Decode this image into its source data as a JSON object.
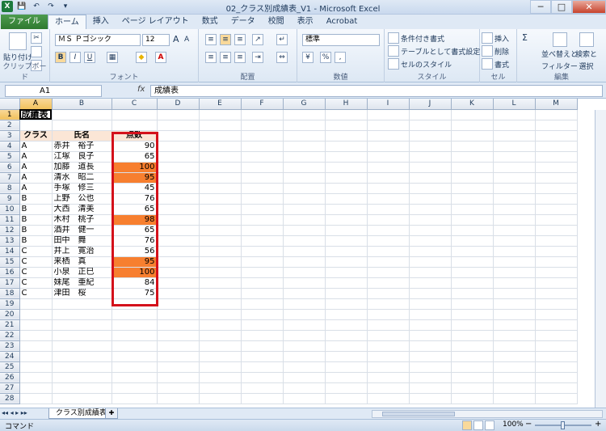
{
  "window": {
    "title": "02_クラス別成績表_V1 - Microsoft Excel",
    "minimize": "─",
    "maximize": "□",
    "close": "✕"
  },
  "qat": {
    "logo": "X",
    "save": "💾",
    "undo": "↶",
    "redo": "↷",
    "more": "▾"
  },
  "tabs": [
    "ファイル",
    "ホーム",
    "挿入",
    "ページ レイアウト",
    "数式",
    "データ",
    "校閲",
    "表示",
    "Acrobat"
  ],
  "ribbon": {
    "clipboard": {
      "label": "クリップボード",
      "paste": "貼り付け"
    },
    "font": {
      "label": "フォント",
      "name": "ＭＳ Ｐゴシック",
      "size": "12",
      "bold": "B",
      "italic": "I",
      "underline": "U",
      "grow": "A",
      "shrink": "A",
      "fontcolor": "A",
      "fill": "◆"
    },
    "alignment": {
      "label": "配置"
    },
    "number": {
      "label": "数値",
      "format": "標準",
      "percent": "%",
      "comma": ","
    },
    "styles": {
      "label": "スタイル",
      "conditional": "条件付き書式",
      "table": "テーブルとして書式設定",
      "cellstyle": "セルのスタイル"
    },
    "cells": {
      "label": "セル",
      "insert": "挿入",
      "delete": "削除",
      "format": "書式"
    },
    "editing": {
      "label": "編集",
      "sigma": "Σ",
      "sort": "並べ替えと",
      "sort2": "フィルター",
      "find": "検索と",
      "find2": "選択"
    }
  },
  "formula_bar": {
    "namebox": "A1",
    "fx": "fx",
    "content": "成績表"
  },
  "columns": [
    "A",
    "B",
    "C",
    "D",
    "E",
    "F",
    "G",
    "H",
    "I",
    "J",
    "K",
    "L",
    "M"
  ],
  "sheet": {
    "title": "成績表",
    "header": {
      "class": "クラス",
      "name": "氏名",
      "score": "点数"
    },
    "rows": [
      {
        "class": "A",
        "name": "赤井　裕子",
        "score": "90",
        "hl": false
      },
      {
        "class": "A",
        "name": "江塚　良子",
        "score": "65",
        "hl": false
      },
      {
        "class": "A",
        "name": "加藤　道長",
        "score": "100",
        "hl": true
      },
      {
        "class": "A",
        "name": "清水　昭二",
        "score": "95",
        "hl": true
      },
      {
        "class": "A",
        "name": "手塚　修三",
        "score": "45",
        "hl": false
      },
      {
        "class": "B",
        "name": "上野　公也",
        "score": "76",
        "hl": false
      },
      {
        "class": "B",
        "name": "大西　清美",
        "score": "65",
        "hl": false
      },
      {
        "class": "B",
        "name": "木村　桃子",
        "score": "98",
        "hl": true
      },
      {
        "class": "B",
        "name": "酒井　健一",
        "score": "65",
        "hl": false
      },
      {
        "class": "B",
        "name": "田中　舞",
        "score": "76",
        "hl": false
      },
      {
        "class": "C",
        "name": "井上　寛治",
        "score": "56",
        "hl": false
      },
      {
        "class": "C",
        "name": "来栖　真",
        "score": "95",
        "hl": true
      },
      {
        "class": "C",
        "name": "小泉　正巳",
        "score": "100",
        "hl": true
      },
      {
        "class": "C",
        "name": "妹尾　亜紀",
        "score": "84",
        "hl": false
      },
      {
        "class": "C",
        "name": "津田　桜",
        "score": "75",
        "hl": false
      }
    ],
    "highlight_color": "#f77f2f"
  },
  "sheet_tabs": {
    "name": "クラス別成績表",
    "nav": "◂◂ ◂ ▸ ▸▸"
  },
  "status": {
    "mode": "コマンド",
    "zoom": "100%",
    "minus": "−",
    "plus": "+"
  }
}
